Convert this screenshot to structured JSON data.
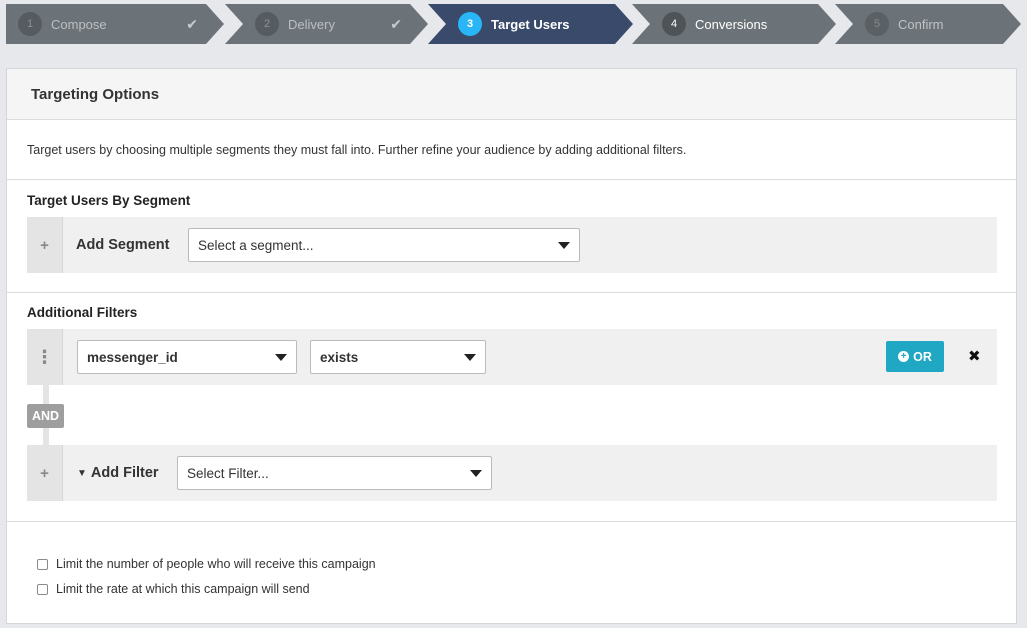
{
  "wizard": {
    "steps": [
      {
        "number": "1",
        "label": "Compose",
        "state": "done"
      },
      {
        "number": "2",
        "label": "Delivery",
        "state": "done"
      },
      {
        "number": "3",
        "label": "Target Users",
        "state": "active"
      },
      {
        "number": "4",
        "label": "Conversions",
        "state": "next"
      },
      {
        "number": "5",
        "label": "Confirm",
        "state": "future"
      }
    ],
    "check_glyph": "✔"
  },
  "panel": {
    "title": "Targeting Options",
    "intro": "Target users by choosing multiple segments they must fall into. Further refine your audience by adding additional filters."
  },
  "segment": {
    "section_title": "Target Users By Segment",
    "add_label": "Add Segment",
    "select_placeholder": "Select a segment...",
    "plus_glyph": "+"
  },
  "filters": {
    "section_title": "Additional Filters",
    "rows": [
      {
        "field": "messenger_id",
        "operator": "exists"
      }
    ],
    "or_label": "OR",
    "close_glyph": "✖",
    "handle_glyph": "⋮",
    "and_label": "AND",
    "add_filter_label": "Add Filter",
    "add_filter_placeholder": "Select Filter...",
    "plus_glyph": "+",
    "filter_glyph": "▼"
  },
  "limits": {
    "limit_people": "Limit the number of people who will receive this campaign",
    "limit_rate": "Limit the rate at which this campaign will send"
  },
  "colors": {
    "active_step": "#3a4a6b",
    "step_bg": "#6c7378",
    "accent": "#1fa7c4",
    "step_number_active": "#29b6f6"
  }
}
